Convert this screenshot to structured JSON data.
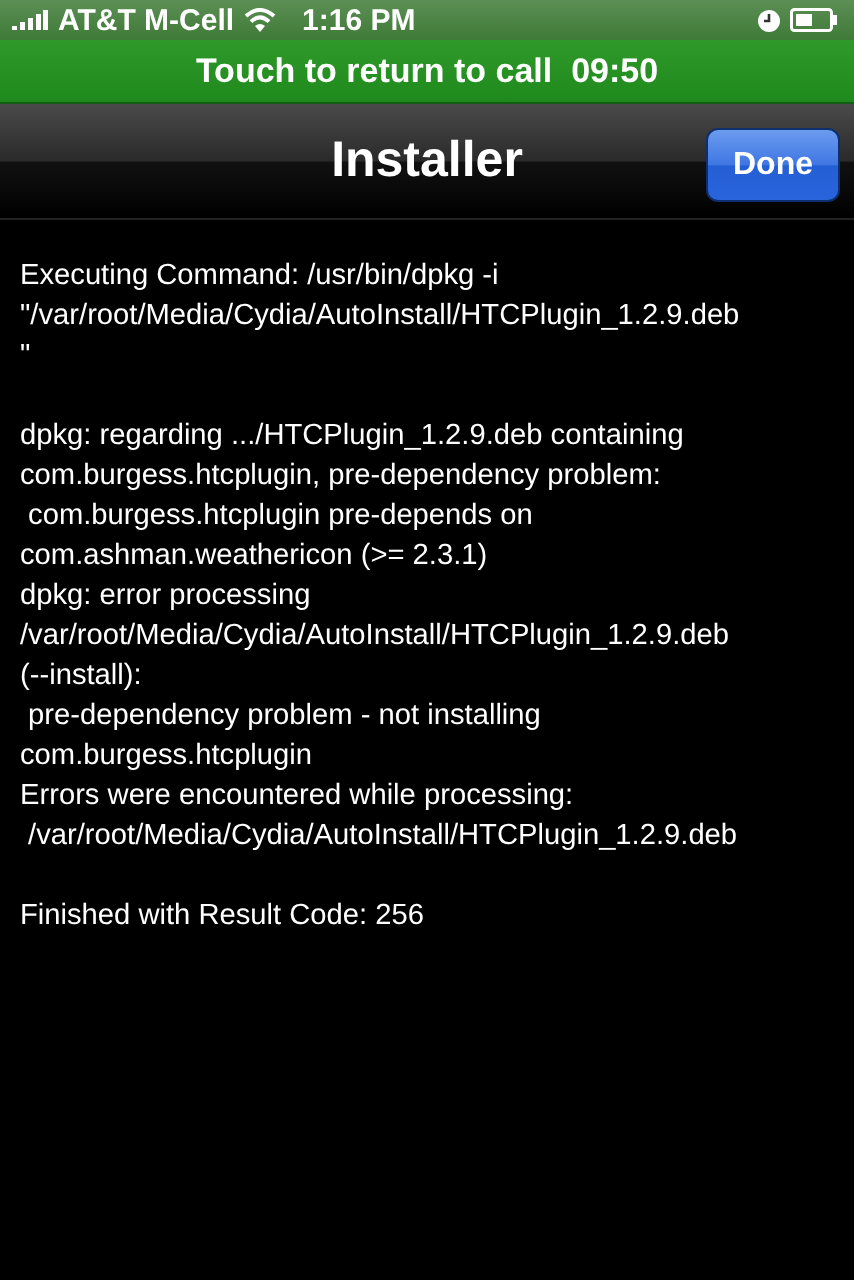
{
  "status_bar": {
    "carrier": "AT&T M-Cell",
    "time": "1:16 PM"
  },
  "call_banner": {
    "label": "Touch to return to call",
    "duration": "09:50"
  },
  "nav_bar": {
    "title": "Installer",
    "button": "Done"
  },
  "output": [
    [
      "Executing Command: /usr/bin/dpkg -i",
      "\"/var/root/Media/Cydia/AutoInstall/HTCPlugin_1.2.9.deb",
      "\""
    ],
    [
      "dpkg: regarding .../HTCPlugin_1.2.9.deb containing",
      "com.burgess.htcplugin, pre-dependency problem:",
      " com.burgess.htcplugin pre-depends on",
      "com.ashman.weathericon (>= 2.3.1)",
      "dpkg: error processing",
      "/var/root/Media/Cydia/AutoInstall/HTCPlugin_1.2.9.deb",
      "(--install):",
      " pre-dependency problem - not installing",
      "com.burgess.htcplugin",
      "Errors were encountered while processing:",
      " /var/root/Media/Cydia/AutoInstall/HTCPlugin_1.2.9.deb"
    ],
    [
      "Finished with Result Code: 256"
    ]
  ]
}
